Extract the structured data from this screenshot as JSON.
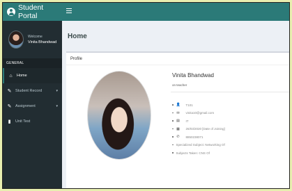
{
  "app": {
    "title": "Student Portal"
  },
  "sidebar": {
    "welcome": "Welcome",
    "user_name": "Vinita Bhandwad",
    "section": "GENERAL",
    "items": [
      {
        "label": "Home",
        "icon": "home-icon",
        "active": true
      },
      {
        "label": "Student Record",
        "icon": "edit-icon",
        "has_children": true
      },
      {
        "label": "Assignment",
        "icon": "edit-icon",
        "has_children": true
      },
      {
        "label": "Unit Test",
        "icon": "file-icon"
      }
    ]
  },
  "page": {
    "title": "Home"
  },
  "profile": {
    "box_title": "Profile",
    "name": "Vinita Bhandwad",
    "role": "on teacher",
    "details": [
      {
        "icon": "user-icon",
        "glyph": "👤",
        "value": "T101"
      },
      {
        "icon": "envelope-icon",
        "glyph": "✉",
        "value": "vinita10@gmail.com"
      },
      {
        "icon": "id-card-icon",
        "glyph": "▤",
        "value": "IT"
      },
      {
        "icon": "calendar-icon",
        "glyph": "▦",
        "value": "26/03/2020 [Date of Joining]"
      },
      {
        "icon": "phone-icon",
        "glyph": "✆",
        "value": "8850238071"
      },
      {
        "icon": "",
        "glyph": "",
        "value": "Specialized Subject: Networking Of"
      },
      {
        "icon": "",
        "glyph": "",
        "value": "Subjects Taken: CNS Of"
      }
    ]
  },
  "colors": {
    "accent": "#2b7a78",
    "sidebar": "#222d32",
    "page_bg": "#ecf0f5"
  }
}
